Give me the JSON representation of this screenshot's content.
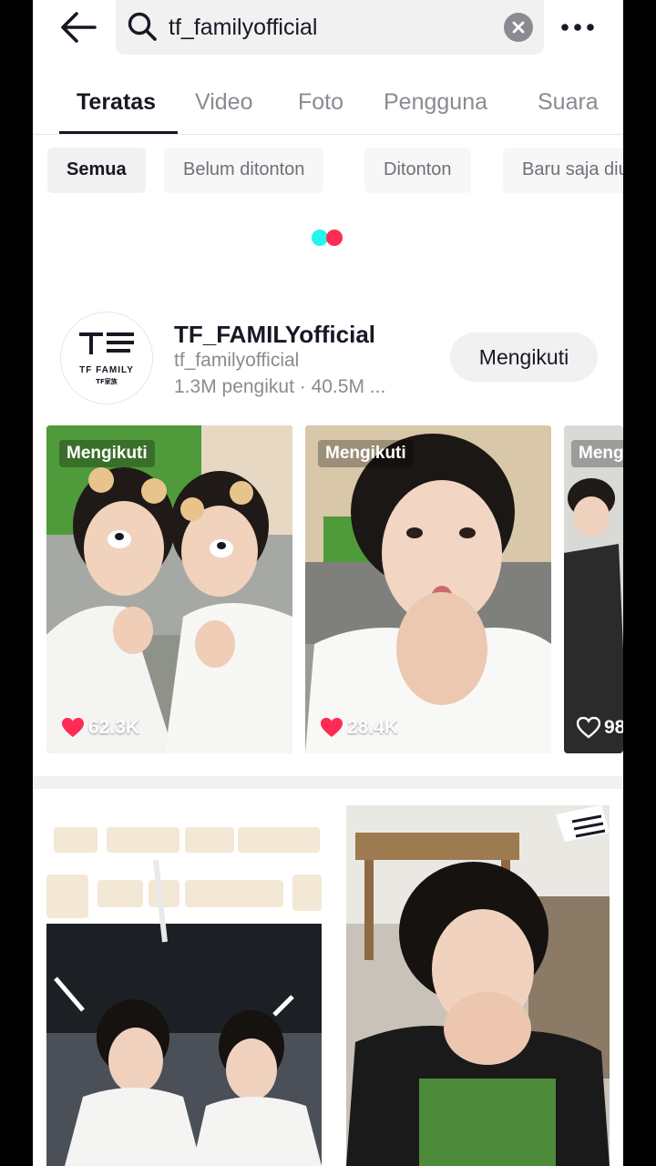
{
  "search": {
    "query": "tf_familyofficial"
  },
  "icons": {
    "back": "back-arrow-icon",
    "search": "search-icon",
    "clear": "clear-icon",
    "more": "more-icon",
    "heart": "heart-icon"
  },
  "colors": {
    "accent_red": "#fe2c55",
    "accent_cyan": "#25f4ee",
    "text_primary": "#161823",
    "text_secondary": "#8a8b91"
  },
  "tabs": [
    {
      "label": "Teratas",
      "active": true
    },
    {
      "label": "Video"
    },
    {
      "label": "Foto"
    },
    {
      "label": "Pengguna"
    },
    {
      "label": "Suara"
    }
  ],
  "filters": [
    {
      "label": "Semua",
      "active": true
    },
    {
      "label": "Belum ditonton"
    },
    {
      "label": "Ditonton"
    },
    {
      "label": "Baru saja diunggah"
    }
  ],
  "account": {
    "name": "TF_FAMILYofficial",
    "handle": "tf_familyofficial",
    "stats": "1.3M pengikut · 40.5M ...",
    "follow_label": "Mengikuti",
    "logo_text": "TF FAMILY",
    "logo_subtext": "TF家族"
  },
  "videos": [
    {
      "badge": "Mengikuti",
      "likes": "62.3K",
      "liked": true
    },
    {
      "badge": "Mengikuti",
      "likes": "28.4K",
      "liked": true
    },
    {
      "badge": "Mengikuti",
      "likes": "98",
      "liked": false
    }
  ]
}
